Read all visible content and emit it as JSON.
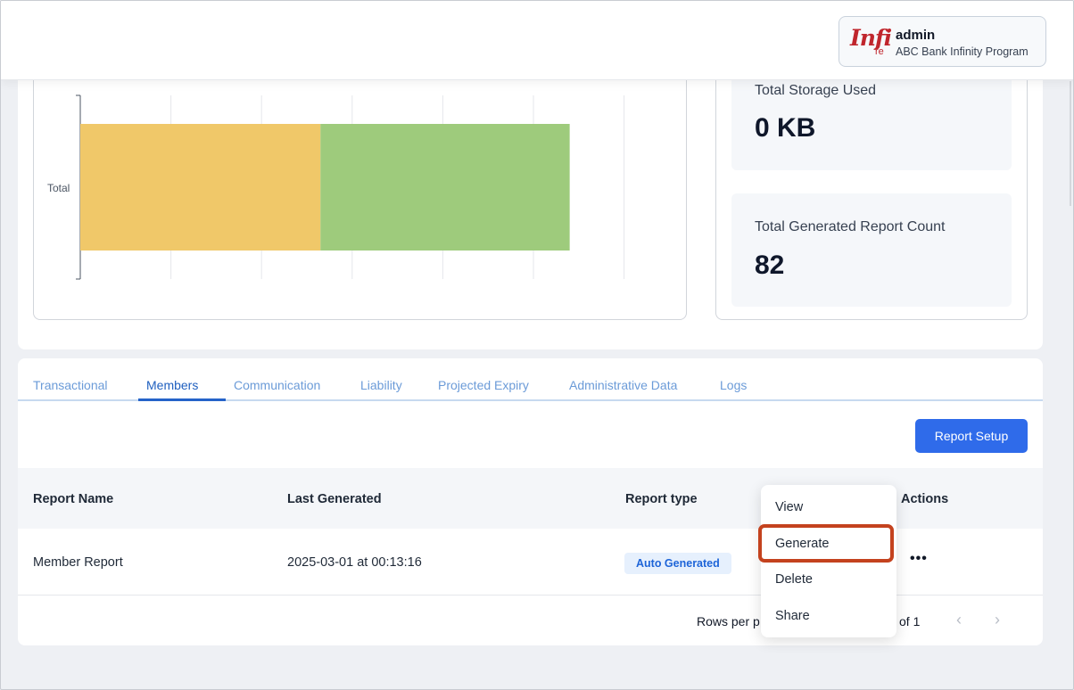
{
  "header": {
    "logo_text": "Infi",
    "logo_sub": "re",
    "user_name": "admin",
    "user_org": "ABC Bank Infinity Program"
  },
  "chart_data": {
    "type": "bar",
    "orientation": "horizontal",
    "stacked": true,
    "categories": [
      "Total"
    ],
    "category_label_shown": "Total",
    "series": [
      {
        "values": [
          53
        ],
        "color": "#f0c869"
      },
      {
        "values": [
          55
        ],
        "color": "#9ecb7c"
      }
    ],
    "grid": true
  },
  "stats": {
    "storage_label": "Total Storage Used",
    "storage_value": "0 KB",
    "report_count_label": "Total Generated Report Count",
    "report_count_value": "82"
  },
  "tabs": [
    {
      "label": "Transactional",
      "active": false
    },
    {
      "label": "Members",
      "active": true
    },
    {
      "label": "Communication",
      "active": false
    },
    {
      "label": "Liability",
      "active": false
    },
    {
      "label": "Projected Expiry",
      "active": false
    },
    {
      "label": "Administrative Data",
      "active": false
    },
    {
      "label": "Logs",
      "active": false
    }
  ],
  "report_setup_label": "Report Setup",
  "table": {
    "headers": [
      "Report Name",
      "Last Generated",
      "Report type",
      "Actions"
    ],
    "rows": [
      {
        "name": "Member Report",
        "last_generated": "2025-03-01 at 00:13:16",
        "type": "Auto Generated",
        "actions": "•••"
      }
    ]
  },
  "pagination": {
    "rows_per_page_label": "Rows per p",
    "page_info": "of 1",
    "prev": "‹",
    "next": "›"
  },
  "action_menu": {
    "items": [
      "View",
      "Generate",
      "Delete",
      "Share"
    ],
    "highlighted": "Generate"
  },
  "colors": {
    "accent": "#2f6bea",
    "highlight": "#c4421e"
  }
}
